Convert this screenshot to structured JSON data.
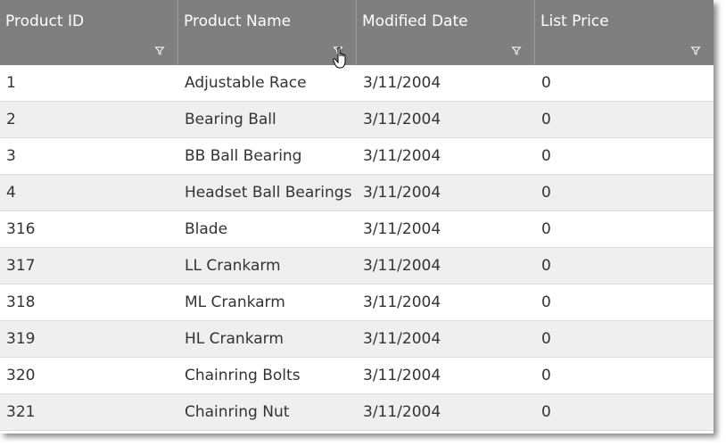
{
  "grid": {
    "columns": [
      {
        "label": "Product ID",
        "filter_icon": "filter-icon"
      },
      {
        "label": "Product Name",
        "filter_icon": "filter-icon"
      },
      {
        "label": "Modified Date",
        "filter_icon": "filter-icon"
      },
      {
        "label": "List Price",
        "filter_icon": "filter-icon"
      }
    ],
    "rows": [
      [
        "1",
        "Adjustable Race",
        "3/11/2004",
        "0"
      ],
      [
        "2",
        "Bearing Ball",
        "3/11/2004",
        "0"
      ],
      [
        "3",
        "BB Ball Bearing",
        "3/11/2004",
        "0"
      ],
      [
        "4",
        "Headset Ball Bearings",
        "3/11/2004",
        "0"
      ],
      [
        "316",
        "Blade",
        "3/11/2004",
        "0"
      ],
      [
        "317",
        "LL Crankarm",
        "3/11/2004",
        "0"
      ],
      [
        "318",
        "ML Crankarm",
        "3/11/2004",
        "0"
      ],
      [
        "319",
        "HL Crankarm",
        "3/11/2004",
        "0"
      ],
      [
        "320",
        "Chainring Bolts",
        "3/11/2004",
        "0"
      ],
      [
        "321",
        "Chainring Nut",
        "3/11/2004",
        "0"
      ]
    ]
  },
  "colors": {
    "header_bg": "#7f7f7f",
    "header_text": "#ffffff",
    "alt_row_bg": "#efefef"
  },
  "cursor": {
    "icon": "hand-pointer-icon"
  }
}
